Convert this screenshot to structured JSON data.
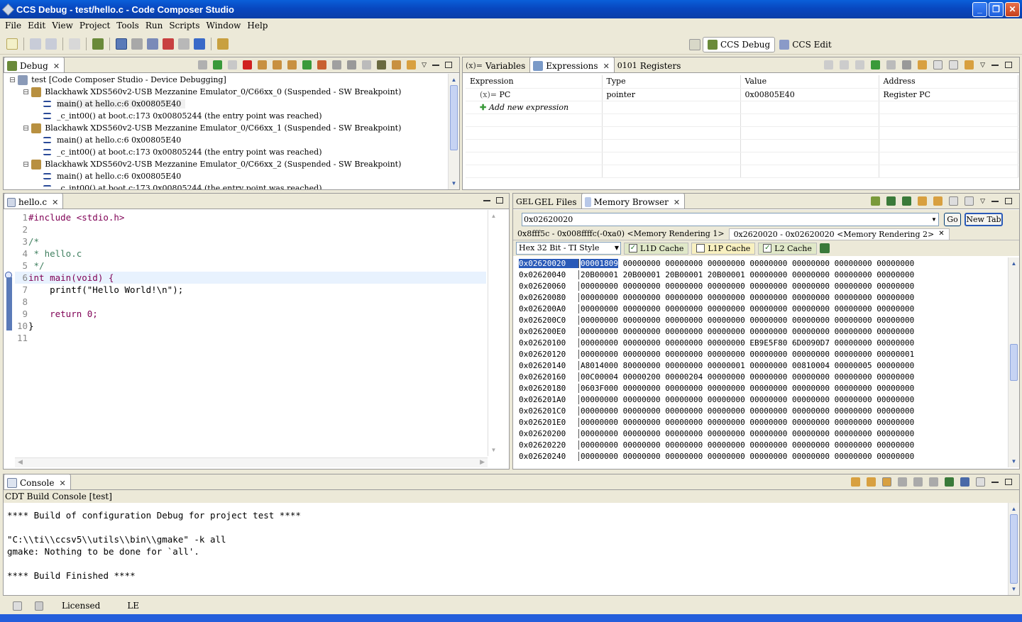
{
  "window": {
    "title": "CCS Debug - test/hello.c - Code Composer Studio"
  },
  "menu": [
    "File",
    "Edit",
    "View",
    "Project",
    "Tools",
    "Run",
    "Scripts",
    "Window",
    "Help"
  ],
  "perspectives": {
    "debug": "CCS Debug",
    "edit": "CCS Edit"
  },
  "debug_view": {
    "tab": "Debug",
    "items": [
      {
        "indent": 0,
        "text": "test [Code Composer Studio - Device Debugging]"
      },
      {
        "indent": 1,
        "text": "Blackhawk XDS560v2-USB Mezzanine Emulator_0/C66xx_0  (Suspended - SW Breakpoint)"
      },
      {
        "indent": 2,
        "text": "main() at hello.c:6 0x00805E40"
      },
      {
        "indent": 2,
        "text": "_c_int00() at boot.c:173 0x00805244  (the entry point was reached)"
      },
      {
        "indent": 1,
        "text": "Blackhawk XDS560v2-USB Mezzanine Emulator_0/C66xx_1  (Suspended - SW Breakpoint)"
      },
      {
        "indent": 2,
        "text": "main() at hello.c:6 0x00805E40"
      },
      {
        "indent": 2,
        "text": "_c_int00() at boot.c:173 0x00805244  (the entry point was reached)"
      },
      {
        "indent": 1,
        "text": "Blackhawk XDS560v2-USB Mezzanine Emulator_0/C66xx_2  (Suspended - SW Breakpoint)"
      },
      {
        "indent": 2,
        "text": "main() at hello.c:6 0x00805E40"
      },
      {
        "indent": 2,
        "text": "_c_int00() at boot.c:173 0x00805244  (the entry point was reached)"
      }
    ]
  },
  "expressions_view": {
    "tabs": [
      "Variables",
      "Expressions",
      "Registers"
    ],
    "columns": [
      "Expression",
      "Type",
      "Value",
      "Address"
    ],
    "rows": [
      {
        "expression": "PC",
        "type": "pointer",
        "value": "0x00805E40",
        "address": "Register PC"
      }
    ],
    "add_new": "Add new expression"
  },
  "editor": {
    "tab": "hello.c",
    "lines": [
      {
        "n": "1",
        "code": "#include <stdio.h>"
      },
      {
        "n": "2",
        "code": ""
      },
      {
        "n": "3",
        "code": "/*"
      },
      {
        "n": "4",
        "code": " * hello.c"
      },
      {
        "n": "5",
        "code": " */"
      },
      {
        "n": "6",
        "code": "int main(void) {"
      },
      {
        "n": "7",
        "code": "    printf(\"Hello World!\\n\");"
      },
      {
        "n": "8",
        "code": ""
      },
      {
        "n": "9",
        "code": "    return 0;"
      },
      {
        "n": "10",
        "code": "}"
      },
      {
        "n": "11",
        "code": ""
      }
    ]
  },
  "memory_view": {
    "tabs": [
      "GEL Files",
      "Memory Browser"
    ],
    "address_input": "0x02620020",
    "go": "Go",
    "new_tab": "New Tab",
    "renderings": [
      "0x8fff5c - 0x008ffffc(-0xa0) <Memory Rendering 1>",
      "0x2620020 - 0x02620020 <Memory Rendering 2>"
    ],
    "format": "Hex 32 Bit - TI Style",
    "caches": [
      {
        "label": "L1D Cache",
        "checked": true
      },
      {
        "label": "L1P Cache",
        "checked": false
      },
      {
        "label": "L2 Cache",
        "checked": true
      }
    ],
    "rows": [
      {
        "addr": "0x02620020",
        "words": "00001809 00000000 00000000 00000000 00000000 00000000 00000000 00000000"
      },
      {
        "addr": "0x02620040",
        "words": "20B00001 20B00001 20B00001 20B00001 00000000 00000000 00000000 00000000"
      },
      {
        "addr": "0x02620060",
        "words": "00000000 00000000 00000000 00000000 00000000 00000000 00000000 00000000"
      },
      {
        "addr": "0x02620080",
        "words": "00000000 00000000 00000000 00000000 00000000 00000000 00000000 00000000"
      },
      {
        "addr": "0x026200A0",
        "words": "00000000 00000000 00000000 00000000 00000000 00000000 00000000 00000000"
      },
      {
        "addr": "0x026200C0",
        "words": "00000000 00000000 00000000 00000000 00000000 00000000 00000000 00000000"
      },
      {
        "addr": "0x026200E0",
        "words": "00000000 00000000 00000000 00000000 00000000 00000000 00000000 00000000"
      },
      {
        "addr": "0x02620100",
        "words": "00000000 00000000 00000000 00000000 EB9E5F80 6D0090D7 00000000 00000000"
      },
      {
        "addr": "0x02620120",
        "words": "00000000 00000000 00000000 00000000 00000000 00000000 00000000 00000001"
      },
      {
        "addr": "0x02620140",
        "words": "A8014000 80000000 00000000 00000001 00000000 00810004 00000005 00000000"
      },
      {
        "addr": "0x02620160",
        "words": "00C00004 00000200 00000204 00000000 00000000 00000000 00000000 00000000"
      },
      {
        "addr": "0x02620180",
        "words": "0603F000 00000000 00000000 00000000 00000000 00000000 00000000 00000000"
      },
      {
        "addr": "0x026201A0",
        "words": "00000000 00000000 00000000 00000000 00000000 00000000 00000000 00000000"
      },
      {
        "addr": "0x026201C0",
        "words": "00000000 00000000 00000000 00000000 00000000 00000000 00000000 00000000"
      },
      {
        "addr": "0x026201E0",
        "words": "00000000 00000000 00000000 00000000 00000000 00000000 00000000 00000000"
      },
      {
        "addr": "0x02620200",
        "words": "00000000 00000000 00000000 00000000 00000000 00000000 00000000 00000000"
      },
      {
        "addr": "0x02620220",
        "words": "00000000 00000000 00000000 00000000 00000000 00000000 00000000 00000000"
      },
      {
        "addr": "0x02620240",
        "words": "00000000 00000000 00000000 00000000 00000000 00000000 00000000 00000000"
      }
    ]
  },
  "console": {
    "tab": "Console",
    "subtitle": "CDT Build Console [test]",
    "lines": [
      "**** Build of configuration Debug for project test ****",
      "",
      "\"C:\\\\ti\\\\ccsv5\\\\utils\\\\bin\\\\gmake\" -k all",
      "gmake: Nothing to be done for `all'.",
      "",
      "**** Build Finished ****"
    ]
  },
  "status": {
    "license": "Licensed",
    "endian": "LE"
  }
}
